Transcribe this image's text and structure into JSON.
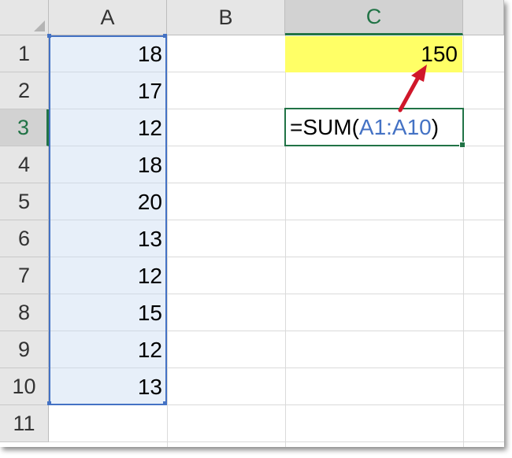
{
  "columns": [
    "A",
    "B",
    "C"
  ],
  "active_column": "C",
  "rows": [
    "1",
    "2",
    "3",
    "4",
    "5",
    "6",
    "7",
    "8",
    "9",
    "10",
    "11"
  ],
  "active_row": "3",
  "column_a_values": [
    "18",
    "17",
    "12",
    "18",
    "20",
    "13",
    "12",
    "15",
    "12",
    "13"
  ],
  "selected_range": "A1:A10",
  "cells": {
    "c1_value": "150",
    "c3_formula_prefix": "=SUM(",
    "c3_formula_ref": "A1:A10",
    "c3_formula_suffix": ")"
  },
  "colors": {
    "highlight_fill": "#ffff66",
    "range_fill": "#dce6f4",
    "range_border": "#4472c4",
    "active_header": "#217346",
    "arrow": "#d0172a"
  },
  "annotation": {
    "type": "arrow",
    "from_cell": "C3",
    "to_cell": "C1"
  }
}
